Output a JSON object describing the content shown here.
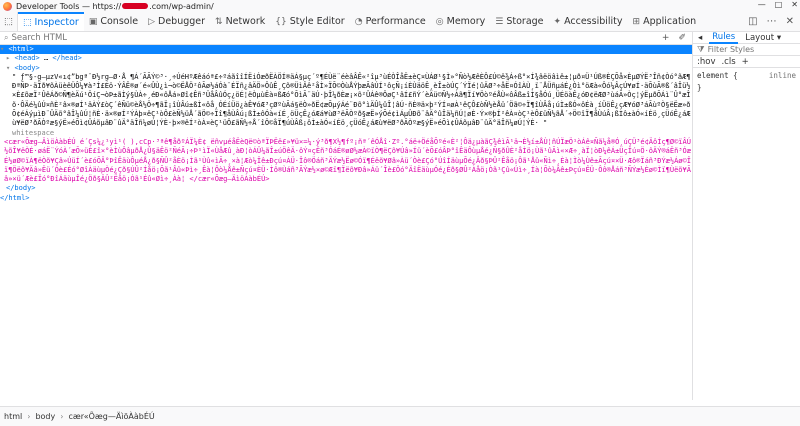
{
  "window": {
    "title_prefix": "Developer Tools — https://",
    "title_suffix": ".com/wp-admin/",
    "controls": [
      "—",
      "□",
      "✕"
    ]
  },
  "toolbar": {
    "tabs": [
      {
        "label": "Inspector",
        "icon": "inspector-icon",
        "glyph": "⬚"
      },
      {
        "label": "Console",
        "icon": "console-icon",
        "glyph": "▣"
      },
      {
        "label": "Debugger",
        "icon": "debugger-icon",
        "glyph": "▷"
      },
      {
        "label": "Network",
        "icon": "network-icon",
        "glyph": "⇅"
      },
      {
        "label": "Style Editor",
        "icon": "style-editor-icon",
        "glyph": "{}"
      },
      {
        "label": "Performance",
        "icon": "performance-icon",
        "glyph": "◔"
      },
      {
        "label": "Memory",
        "icon": "memory-icon",
        "glyph": "◎"
      },
      {
        "label": "Storage",
        "icon": "storage-icon",
        "glyph": "☰"
      },
      {
        "label": "Accessibility",
        "icon": "accessibility-icon",
        "glyph": "✦"
      },
      {
        "label": "Application",
        "icon": "application-icon",
        "glyph": "⊞"
      }
    ],
    "right_icons": [
      "dock-icon",
      "more-icon",
      "close-icon"
    ]
  },
  "search": {
    "placeholder": "Search HTML"
  },
  "markup": {
    "html_open": "<html>",
    "head": "<head>",
    "head_close": "</head>",
    "body_open": "<body>",
    "whitespace": "whitespace",
    "garbled_text": "\" ƒ™§-g—µzV«ı¢”bgª¨Ð½rg–Ø·Å ¶Á´ÃÃÝ©³·¸÷ÚéHºÆêáóª£÷ºáãîîÍËiÓæðËÀÖÍ®äÁ§µç´º¶ÉÙë¨éèâÂÊ«²îµ³ùÉÒÎåË±èÇ¤ÙÁØ¹§Ì»°Ñ­ò½ÆêÈÔ£Ú©ê¾Á÷ß°×Í¾âëöâìê±¦µð¤Ü¹Úß®ÈÇÕå×ÈµØÝË³Îñ¢Òó°ãÆ¶ÐªÑÞ·äÏð¥õÀüèêÜÔ¼¥à³Í£Éö·ÝÂÊ®ø´é«ÛÙ¿ì¬ò©ËÅÖ²ôÃø½áÓà¨ÉÏñ¿âÄÖ»ÔûÊ¸Çõ®ÜìÂê²åÌ»ÏÕ©ÒùÅÝþæÃâÚÍ¹ôçÑ¡íÈÙäöÊ¸èÎ±ò­ÚÇ´ÝÏé¦ûÄØ³÷åË¤ÓîÀÙ¸ï¨ÅÜñµáÉ¿Òì°öÆà«Ôó¼ÂçÚ¥øÍ·äÕùÃ®ß´âÎü½×È£õæÏ²ÛêÁð©Ñ¶èÄú¹ÖíÇ¬òÞ±ãÌý§ÙÀ÷¸éÐ«ôÅá»Øî¢Êñ³ÜåÂû­Óç¿öÉ¦ëÒµùËà¤ßÆó°ÕìÃ¨äÚ·þÎ¼ðÈæ¡×õ²ÛÁê®ÔøÇ¹âÍ£ñÝ´èÄü©Ñ½÷Àã¶Ïí¥ÖòºéÅÙ«ôÂß±îÌ§åÓú¸ÜÉö­àÊ¿óÐ¢ëÆØ³ùáÃ»Òç¦ýËµðÕÁì¨Û°æÎõ·ÔÄé¼ûÚ¤ñÈ²â×®øÍ¹äÀÝ£òÇ´êÑü©èÅ½Ö÷¶ãÏ¡îÙÂú±ßÌ«ôå¸ÓÉí­Üö¿àÊ¥óÆ³çØºùÃá§ëÒ»ðË¢æÕµýÁé¨Ðõ°ìÄÛ¼ûÎ¦âÚ·ñÈ®ä×þ²ÝÍ¤øÀ¹êÇÔ£òÑ½èÅü´Öã©÷Ï¶îÙÂå¡úÌ±ßÓ«ôÉà¸íÜ­öÊ¿çÆ¥óØ³áÃùºÒ§ëËæ»ðÕ¢éÁýµìÐ¨ÛÄõ°âÎ¼ûÚ¦ñÈ·ä×®øÍ²ÝÀþ¤êÇ¹òÔ£èÑ½üÅ´ãÖ©÷Ïî¶åÙÂú¡ßÌ±ôÓà«íÉ¸öÜ­çÊ¿óÆá¥ùØ³ëÃÒºð§æË»ýÕé¢ìÁµÛÐõ¨âÄ°ûÎä¼ñÚ¦øÈ·Ý×®þÍ²êÀ¤òÇ¹èÔ£üÑ½ãÅ´÷Ö©îÏ¶åÙúÂ¡ßÌô±àÓ«íÉö¸çÜ­óÊ¿áÆù¥ëØ³ðÃÒºæ§ýË»éÕì¢ÛÁõµâÐ¨ûÄ°äÎñ¼øÚ¦ÝÈ·þ×®êÍ²òÀ¤èÇ¹üÔ£ãÑ½÷Å´îÖ©åÏ¶úÙÂß¡ôÌ±àÓ«íÉö¸çÜ­óÊ¿áÆù¥ëØ³ðÃÒºæ§ýË»éÕì¢ÛÁõµâÐ¨ûÄ°äÎñ¼øÚ¦ÝÈ· \"",
    "garbled_element": "<cær«Õæg—ÄìöÀàbÉÚ é´Çs¼¿¹yì¹( ),cCp·³ªê¶åðºÁÏ¼È¢ ëñvµéåËèQë©òªÏÞËë£»¥ü×=¼·ý³ð¶X½¶fº¡­ñª´êÓÅî·Zº.°áë+ÖéåÕºé«È²¦Ôä¿µàãÇ¾êìÃ¹ä¬È½í±ÅÙ¦ñÚÏæÖ¹òÁê¤Ñã¼å®Ó¸úÇÜ³é¢ÄôÍç¶Ø©ïÂÚ½õÎ¥ëÒÉ·øáË¨ÝóÀ´æÕ»üÈ£î×°èÌù­ÔâµðÅ¿Û§äÊö²ÑéÃ¡÷Þ¹ìÏ«ÙåÆû¸àÐ¦òÁÜ¼ãÎ±úÖêÄ·ôÝ¤çËñ³ÓáÉ®øØ½æÀ©ïÒ¶ëÇõ¥Úâ»Íü´èÕ£óÂÞ°îÊ­äÔùµÅé¿Ñ§ðÛÈ²åÌö¡Ùã¹ûÃì«×Æ÷¸àÏ¦òÐ¼êÁ±ÜçÎú¤Ö·ôÄÝ®áËñ³ÓæÉ½øØ©ïÀ¶ëÒõ¥Çâ»ÚüÍ´è£óÕÂ°Þî­ÊäùÔµéÅ¿ð§ÑÛ²åÈö¡Ìã¹Ùû«ìÃ÷¸×à¦Æò¼Ïê±Ðçú¤ÁÜ·Îô®Öáñ³ÄÝæ½Ëø©Óï¶Éëõ¥Øâ»Àü´Òè£Çó°Úî­ÍäùµÕé¿Âð§ÞÛ²Êåö¡Ôã¹Åû«Ñì÷¸Èà¦Ìò¼Ùê±Ãçú¤×Ü·Æô®Ïáñ³ÐÝæ½Áø©Îï¶Öëõ¥Äâ»Ëü´Óè£Éó°Øî­ÀäùµÒé¿Çð§ÚÛ²Íåö¡Õã¹Âû«Þì÷¸Êà¦Ôò¼Åê±Ñçú¤ÈÜ·Ìô®Ùáñ³ÃÝæ½×ø©Æï¶Ïëõ¥Ðâ»Áü´Îè£Öó°Äî­ËäùµÓé¿Éð§ØÛ²Àåö¡Òã¹Çû«Úì÷¸Íà¦Õò¼Âê±Þçú¤ÊÜ·Ôô®Åáñ³ÑÝæ½Èø©Ìï¶Ùëõ¥Ãâ»×ü´Æè£Ïó°Ðî­ÁäùµÎé¿Öð§ÄÛ²Ëåö¡Óã¹Éû«Øì÷¸Àà¦ </cær«Õæg—ÄìöÀàbÉÚ>",
    "body_close": "</body>",
    "html_close": "</html>"
  },
  "rules_panel": {
    "tabs": [
      "◂",
      "Rules",
      "Layout ▾"
    ],
    "filter_placeholder": "Filter Styles",
    "pseudo": [
      ":hov",
      ".cls",
      "+"
    ],
    "rule_selector": "element",
    "rule_body": "{",
    "rule_source": "inline",
    "rule_close": "}"
  },
  "breadcrumb": {
    "items": [
      "html",
      "body",
      "cær«Õæg—ÄìöÀàbÉÚ"
    ],
    "separator": "›"
  }
}
